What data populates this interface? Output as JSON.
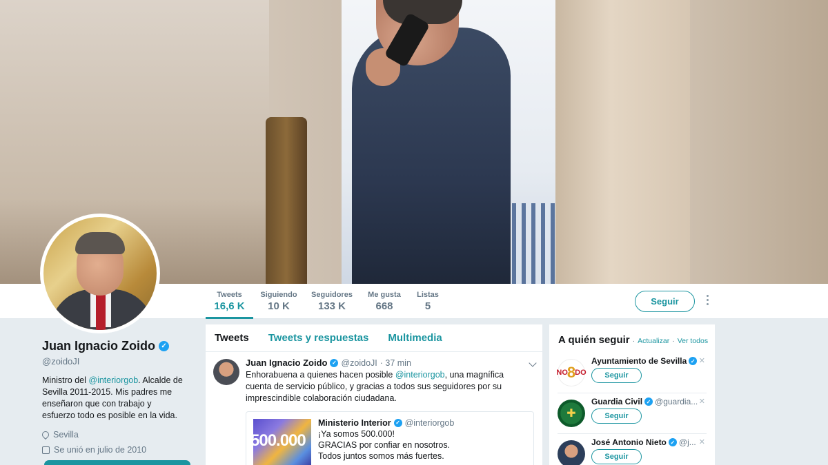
{
  "profile": {
    "name": "Juan Ignacio Zoido",
    "handle": "@zoidoJI",
    "bio_prefix": "Ministro del ",
    "bio_mention": "@interiorgob",
    "bio_suffix": ". Alcalde de Sevilla 2011-2015. Mis padres me enseñaron que con trabajo y esfuerzo todo es posible en la vida.",
    "location": "Sevilla",
    "joined": "Se unió en julio de 2010"
  },
  "stats": [
    {
      "label": "Tweets",
      "value": "16,6 K"
    },
    {
      "label": "Siguiendo",
      "value": "10 K"
    },
    {
      "label": "Seguidores",
      "value": "133 K"
    },
    {
      "label": "Me gusta",
      "value": "668"
    },
    {
      "label": "Listas",
      "value": "5"
    }
  ],
  "follow_label": "Seguir",
  "tabs": [
    "Tweets",
    "Tweets y respuestas",
    "Multimedia"
  ],
  "tweet": {
    "name": "Juan Ignacio Zoido",
    "handle": "@zoidoJI",
    "time": "· 37 min",
    "text_prefix": "Enhorabuena a quienes hacen posible ",
    "text_mention": "@interiorgob",
    "text_suffix": ", una magnífica cuenta de servicio público, y gracias a todos sus seguidores por su imprescindible colaboración ciudadana.",
    "quote": {
      "name": "Ministerio Interior",
      "handle": "@interiorgob",
      "line1": "¡Ya somos 500.000!",
      "line2": "GRACIAS por confiar en nosotros.",
      "line3": "Todos juntos somos más fuertes.",
      "image_text": "500.000"
    }
  },
  "who_to_follow": {
    "title": "A quién seguir",
    "refresh": "Actualizar",
    "separator": "·",
    "view_all": "Ver todos",
    "items": [
      {
        "name": "Ayuntamiento de Sevilla",
        "handle": "",
        "button": "Seguir"
      },
      {
        "name": "Guardia Civil",
        "handle": "@guardia...",
        "button": "Seguir"
      },
      {
        "name": "José Antonio Nieto",
        "handle": "@j...",
        "button": "Seguir"
      }
    ],
    "logo_text_left": "NO",
    "logo_text_eight": "8",
    "logo_text_right": "DO"
  },
  "colors": {
    "accent": "#1b95a0",
    "verified": "#1da1f2",
    "background": "#e6ecf0"
  }
}
